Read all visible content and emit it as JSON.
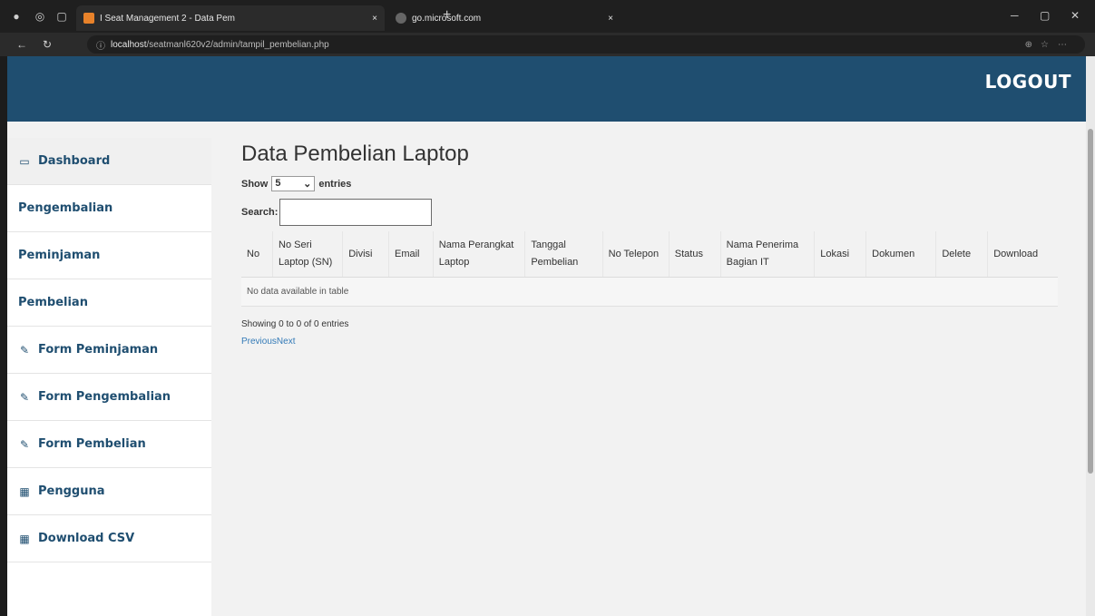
{
  "browser": {
    "tabs": [
      {
        "label": "I Seat Management 2 - Data Pem",
        "active": true
      },
      {
        "label": "go.microsoft.com",
        "active": false
      }
    ],
    "url_host": "localhost",
    "url_path": "/seatmanl620v2/admin/tampil_pembelian.php",
    "new_tab": "+",
    "close": "×"
  },
  "header": {
    "logout_label": "LOGOUT",
    "color": "#1f4e70"
  },
  "sidebar": {
    "items": [
      {
        "label": "Dashboard",
        "icon": "monitor-icon"
      },
      {
        "label": "Pengembalian",
        "icon": ""
      },
      {
        "label": "Peminjaman",
        "icon": ""
      },
      {
        "label": "Pembelian",
        "icon": ""
      },
      {
        "label": "Form Peminjaman",
        "icon": "edit-icon"
      },
      {
        "label": "Form Pengembalian",
        "icon": "edit-icon"
      },
      {
        "label": "Form Pembelian",
        "icon": "edit-icon"
      },
      {
        "label": "Pengguna",
        "icon": "table-icon"
      },
      {
        "label": "Download CSV",
        "icon": "table-icon"
      }
    ]
  },
  "main": {
    "title": "Data Pembelian Laptop",
    "show_label": "Show",
    "entries_value": "5",
    "entries_label": "entries",
    "search_label": "Search:",
    "search_value": "",
    "columns": [
      "No",
      "No Seri Laptop (SN)",
      "Divisi",
      "Email",
      "Nama Perangkat Laptop",
      "Tanggal Pembelian",
      "No Telepon",
      "Status",
      "Nama Penerima Bagian IT",
      "Lokasi",
      "Dokumen",
      "Delete",
      "Download"
    ],
    "empty_message": "No data available in table",
    "info": "Showing 0 to 0 of 0 entries",
    "previous": "Previous",
    "next": "Next"
  }
}
